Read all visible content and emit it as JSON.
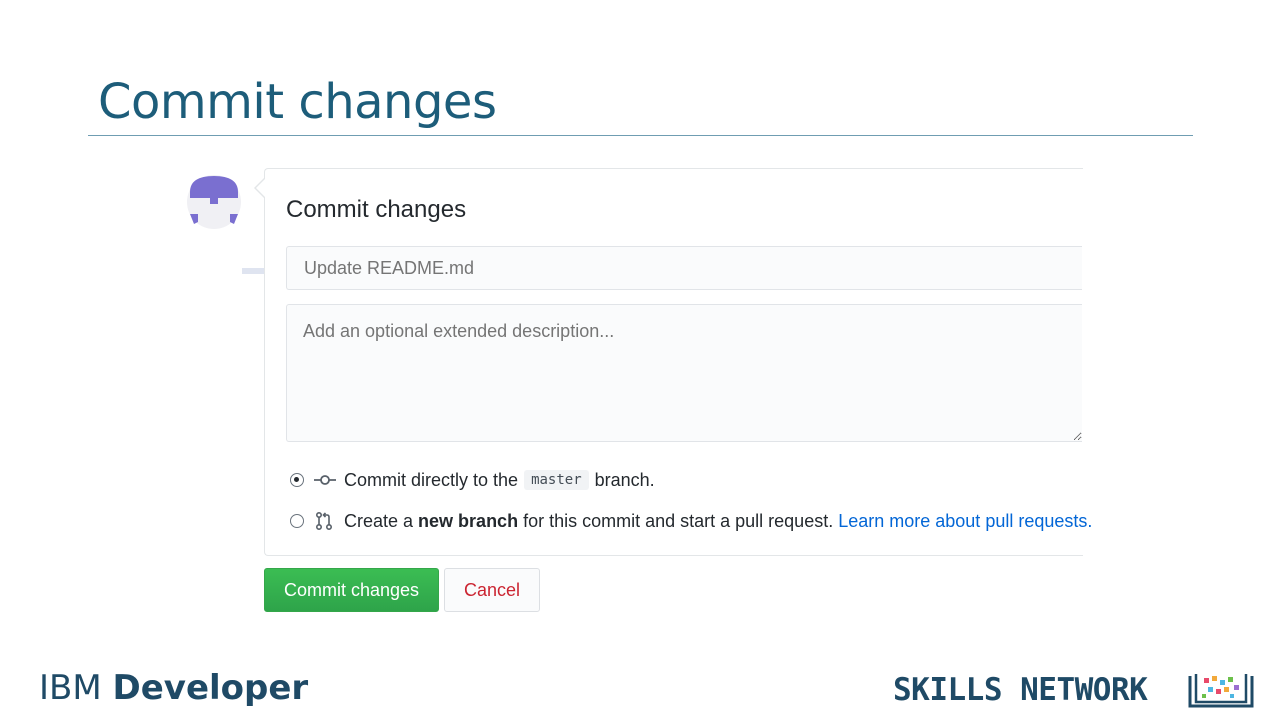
{
  "slide": {
    "title": "Commit changes"
  },
  "commit_form": {
    "heading": "Commit changes",
    "summary_placeholder": "Update README.md",
    "description_placeholder": "Add an optional extended description...",
    "options": [
      {
        "selected": true,
        "before": "Commit directly to the",
        "code": "master",
        "after": "branch."
      },
      {
        "selected": false,
        "before": "Create a",
        "bold": "new branch",
        "after": "for this commit and start a pull request.",
        "link": "Learn more about pull requests."
      }
    ],
    "commit_button": "Commit changes",
    "cancel_button": "Cancel"
  },
  "footer": {
    "ibm_light": "IBM",
    "ibm_bold": "Developer",
    "skills_network": "SKILLS NETWORK"
  },
  "colors": {
    "title": "#1d5d7a",
    "commit_green": "#2ea44a",
    "cancel_red": "#cb2431",
    "link_blue": "#0366d6",
    "brand_navy": "#1f4a66"
  },
  "icons": {
    "avatar": "identicon-avatar",
    "commit_option": "git-commit-icon",
    "branch_option": "git-pull-request-icon",
    "logo": "skills-network-logo-icon"
  }
}
